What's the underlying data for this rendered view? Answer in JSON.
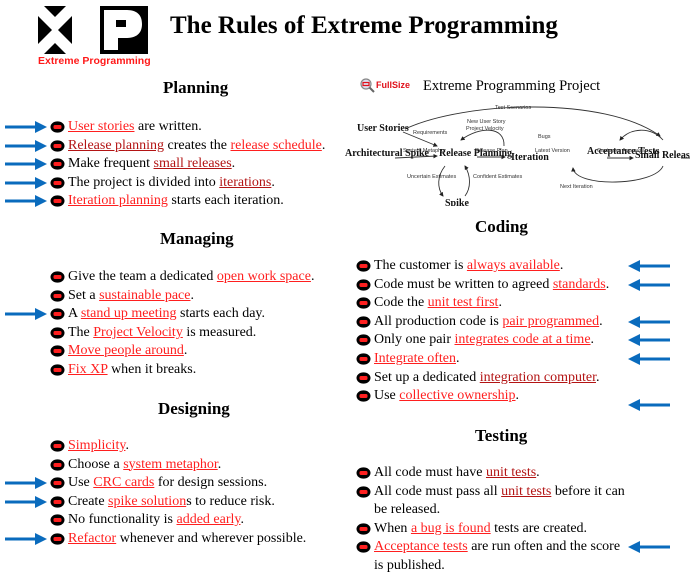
{
  "logo": {
    "mark": "XP",
    "subtitle": "Extreme Programming"
  },
  "title": "The Rules of Extreme Programming",
  "colors": {
    "link": "#ff1f1f",
    "visited_link": "#b31414",
    "arrow": "#0a6bbd",
    "bullet_fill": "#000000",
    "bullet_mark": "#ff2020"
  },
  "icons": {
    "bullet": "xp-bullet-icon",
    "arrow_right": "arrow-right-icon",
    "arrow_left": "arrow-left-icon",
    "magnifier": "magnifier-icon"
  },
  "diagram": {
    "fullsize_label": "FullSize",
    "title": "Extreme Programming Project",
    "nodes": [
      "User Stories",
      "Architectural Spike",
      "Release Planning",
      "Iteration",
      "Acceptance Tests",
      "Small Releases",
      "Spike"
    ],
    "edges": [
      "Test Scenarios",
      "Requirements",
      "New User Story",
      "Project Velocity",
      "System Metaphor",
      "Release Plan",
      "Bugs",
      "Latest Version",
      "Customer Approval",
      "Uncertain Estimates",
      "Confident Estimates",
      "Next Iteration"
    ]
  },
  "sections": {
    "planning": {
      "heading": "Planning",
      "items": [
        {
          "parts": [
            {
              "t": "User stories",
              "link": true
            },
            {
              "t": " are written."
            }
          ],
          "arrow": true
        },
        {
          "parts": [
            {
              "t": "Release planning",
              "link": true,
              "dark": true
            },
            {
              "t": " creates the "
            },
            {
              "t": "release schedule",
              "link": true
            },
            {
              "t": "."
            }
          ],
          "arrow": true
        },
        {
          "parts": [
            {
              "t": "Make frequent "
            },
            {
              "t": "small releases",
              "link": true,
              "dark": true
            },
            {
              "t": "."
            }
          ],
          "arrow": true
        },
        {
          "parts": [
            {
              "t": "The project is divided into "
            },
            {
              "t": "iterations",
              "link": true,
              "dark": true
            },
            {
              "t": "."
            }
          ],
          "arrow": true
        },
        {
          "parts": [
            {
              "t": "Iteration planning",
              "link": true
            },
            {
              "t": " starts each iteration."
            }
          ],
          "arrow": true
        }
      ]
    },
    "managing": {
      "heading": "Managing",
      "items": [
        {
          "parts": [
            {
              "t": "Give the team a dedicated "
            },
            {
              "t": "open work space",
              "link": true
            },
            {
              "t": "."
            }
          ],
          "arrow": false
        },
        {
          "parts": [
            {
              "t": "Set a "
            },
            {
              "t": "sustainable pace",
              "link": true
            },
            {
              "t": "."
            }
          ],
          "arrow": false
        },
        {
          "parts": [
            {
              "t": "A "
            },
            {
              "t": "stand up meeting",
              "link": true
            },
            {
              "t": " starts each day."
            }
          ],
          "arrow": true
        },
        {
          "parts": [
            {
              "t": "The "
            },
            {
              "t": "Project Velocity",
              "link": true
            },
            {
              "t": " is measured."
            }
          ],
          "arrow": false
        },
        {
          "parts": [
            {
              "t": "Move people around",
              "link": true
            },
            {
              "t": "."
            }
          ],
          "arrow": false
        },
        {
          "parts": [
            {
              "t": "Fix XP",
              "link": true
            },
            {
              "t": " when it breaks."
            }
          ],
          "arrow": false
        }
      ]
    },
    "designing": {
      "heading": "Designing",
      "items": [
        {
          "parts": [
            {
              "t": "Simplicity",
              "link": true
            },
            {
              "t": "."
            }
          ],
          "arrow": false
        },
        {
          "parts": [
            {
              "t": "Choose a "
            },
            {
              "t": "system metaphor",
              "link": true
            },
            {
              "t": "."
            }
          ],
          "arrow": false
        },
        {
          "parts": [
            {
              "t": "Use "
            },
            {
              "t": "CRC cards",
              "link": true
            },
            {
              "t": " for design sessions."
            }
          ],
          "arrow": true
        },
        {
          "parts": [
            {
              "t": "Create "
            },
            {
              "t": "spike solution",
              "link": true
            },
            {
              "t": "s to reduce risk."
            }
          ],
          "arrow": true
        },
        {
          "parts": [
            {
              "t": "No functionality is "
            },
            {
              "t": "added early",
              "link": true
            },
            {
              "t": "."
            }
          ],
          "arrow": false
        },
        {
          "parts": [
            {
              "t": "Refactor",
              "link": true
            },
            {
              "t": " whenever and wherever possible."
            }
          ],
          "arrow": true
        }
      ]
    },
    "coding": {
      "heading": "Coding",
      "items": [
        {
          "parts": [
            {
              "t": "The customer is "
            },
            {
              "t": "always available",
              "link": true
            },
            {
              "t": "."
            }
          ],
          "arrow": true
        },
        {
          "parts": [
            {
              "t": "Code must be written to agreed "
            },
            {
              "t": "standards",
              "link": true
            },
            {
              "t": "."
            }
          ],
          "arrow": true
        },
        {
          "parts": [
            {
              "t": "Code the "
            },
            {
              "t": "unit test first",
              "link": true
            },
            {
              "t": "."
            }
          ],
          "arrow": false
        },
        {
          "parts": [
            {
              "t": "All production code is "
            },
            {
              "t": "pair programmed",
              "link": true
            },
            {
              "t": "."
            }
          ],
          "arrow": true
        },
        {
          "parts": [
            {
              "t": "Only one pair "
            },
            {
              "t": "integrates code at a time",
              "link": true
            },
            {
              "t": "."
            }
          ],
          "arrow": true
        },
        {
          "parts": [
            {
              "t": "Integrate often",
              "link": true
            },
            {
              "t": "."
            }
          ],
          "arrow": true
        },
        {
          "parts": [
            {
              "t": "Set up a dedicated "
            },
            {
              "t": "integration computer",
              "link": true,
              "dark": true
            },
            {
              "t": "."
            }
          ],
          "arrow": false
        },
        {
          "parts": [
            {
              "t": "Use "
            },
            {
              "t": "collective ownership",
              "link": true
            },
            {
              "t": "."
            }
          ],
          "arrow": true
        }
      ]
    },
    "testing": {
      "heading": "Testing",
      "items": [
        {
          "parts": [
            {
              "t": "All code must have "
            },
            {
              "t": "unit tests",
              "link": true,
              "dark": true
            },
            {
              "t": "."
            }
          ],
          "arrow": false
        },
        {
          "parts": [
            {
              "t": "All code must pass all "
            },
            {
              "t": "unit tests",
              "link": true,
              "dark": true
            },
            {
              "t": " before it  can"
            }
          ],
          "cont": "be released.",
          "arrow": false
        },
        {
          "parts": [
            {
              "t": "When "
            },
            {
              "t": "a bug is found",
              "link": true
            },
            {
              "t": " tests are created."
            }
          ],
          "arrow": false
        },
        {
          "parts": [
            {
              "t": "Acceptance tests",
              "link": true
            },
            {
              "t": " are run often and the score"
            }
          ],
          "cont": "is published.",
          "arrow": true
        }
      ]
    }
  }
}
